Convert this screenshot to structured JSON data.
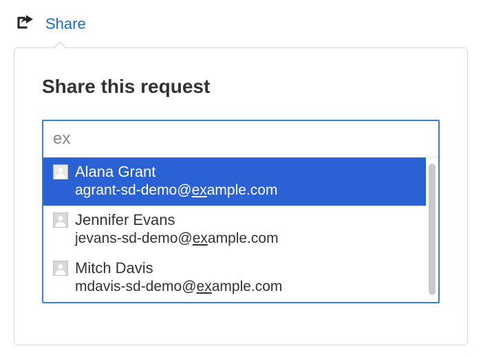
{
  "share": {
    "label": "Share",
    "popover_title": "Share this request",
    "input_value": "ex",
    "input_placeholder": "",
    "options": [
      {
        "name": "Alana Grant",
        "email_before": "agrant-sd-demo@",
        "email_match": "ex",
        "email_after": "ample.com",
        "selected": true
      },
      {
        "name": "Jennifer Evans",
        "email_before": "jevans-sd-demo@",
        "email_match": "ex",
        "email_after": "ample.com",
        "selected": false
      },
      {
        "name": "Mitch Davis",
        "email_before": "mdavis-sd-demo@",
        "email_match": "ex",
        "email_after": "ample.com",
        "selected": false
      }
    ]
  },
  "colors": {
    "accent": "#1a6bc7",
    "selected_bg": "#2a62d6",
    "border_focus": "#3a7fd6"
  }
}
